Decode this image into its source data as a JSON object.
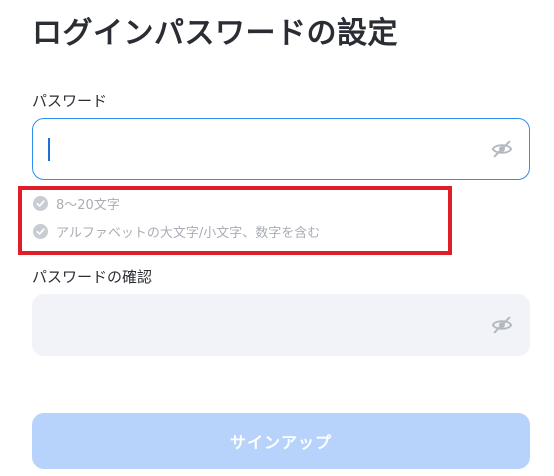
{
  "page": {
    "title": "ログインパスワードの設定"
  },
  "password_field": {
    "label": "パスワード",
    "value": "",
    "placeholder": "",
    "toggle_icon": "eye-slash-icon"
  },
  "rules": [
    {
      "text": "8〜20文字",
      "satisfied": false,
      "icon": "check-circle-icon"
    },
    {
      "text": "アルファベットの大文字/小文字、数字を含む",
      "satisfied": false,
      "icon": "check-circle-icon"
    }
  ],
  "confirm_field": {
    "label": "パスワードの確認",
    "value": "",
    "placeholder": "",
    "toggle_icon": "eye-slash-icon"
  },
  "signup_button": {
    "label": "サインアップ",
    "enabled": false
  },
  "colors": {
    "accent": "#2f8ff0",
    "button_disabled": "#b7d3fb",
    "rule_gray": "#a9adb5",
    "highlight_box": "#e01e2a",
    "input_bg_inactive": "#f1f3f8"
  }
}
